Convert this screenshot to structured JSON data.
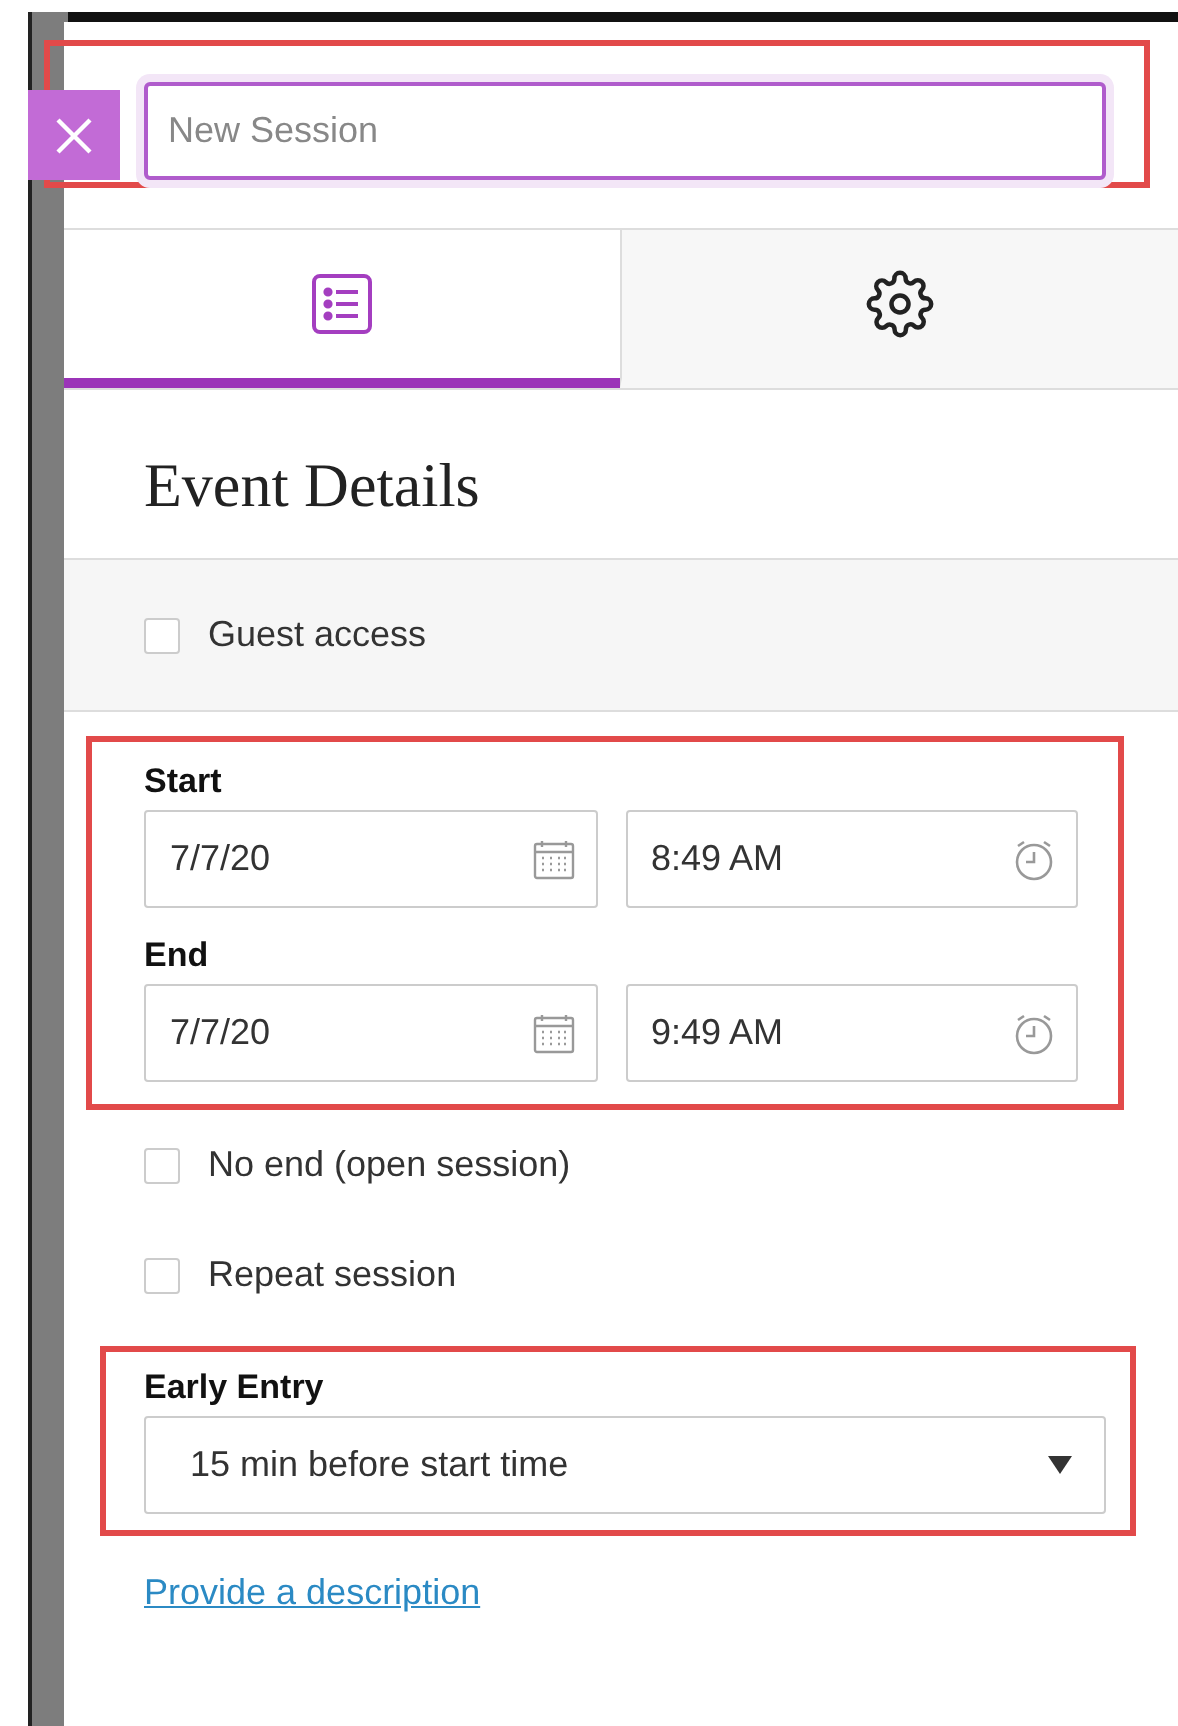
{
  "header": {
    "title_field": {
      "placeholder": "New Session"
    },
    "highlighted": true
  },
  "tabs": [
    {
      "kind": "list",
      "selected": true
    },
    {
      "kind": "settings",
      "selected": false
    }
  ],
  "heading": "Event Details",
  "guest_access": {
    "label": "Guest access",
    "checked": false
  },
  "schedule": {
    "highlighted": true,
    "rows": [
      {
        "label": "Start",
        "date": "7/7/20",
        "time": "8:49 AM"
      },
      {
        "label": "End",
        "date": "7/7/20",
        "time": "9:49 AM"
      }
    ]
  },
  "options": [
    {
      "label": "No end (open session)",
      "checked": false
    },
    {
      "label": "Repeat session",
      "checked": false
    }
  ],
  "early_entry": {
    "label": "Early Entry",
    "value": "15 min before start time",
    "highlighted": true
  },
  "description_link": "Provide a description"
}
